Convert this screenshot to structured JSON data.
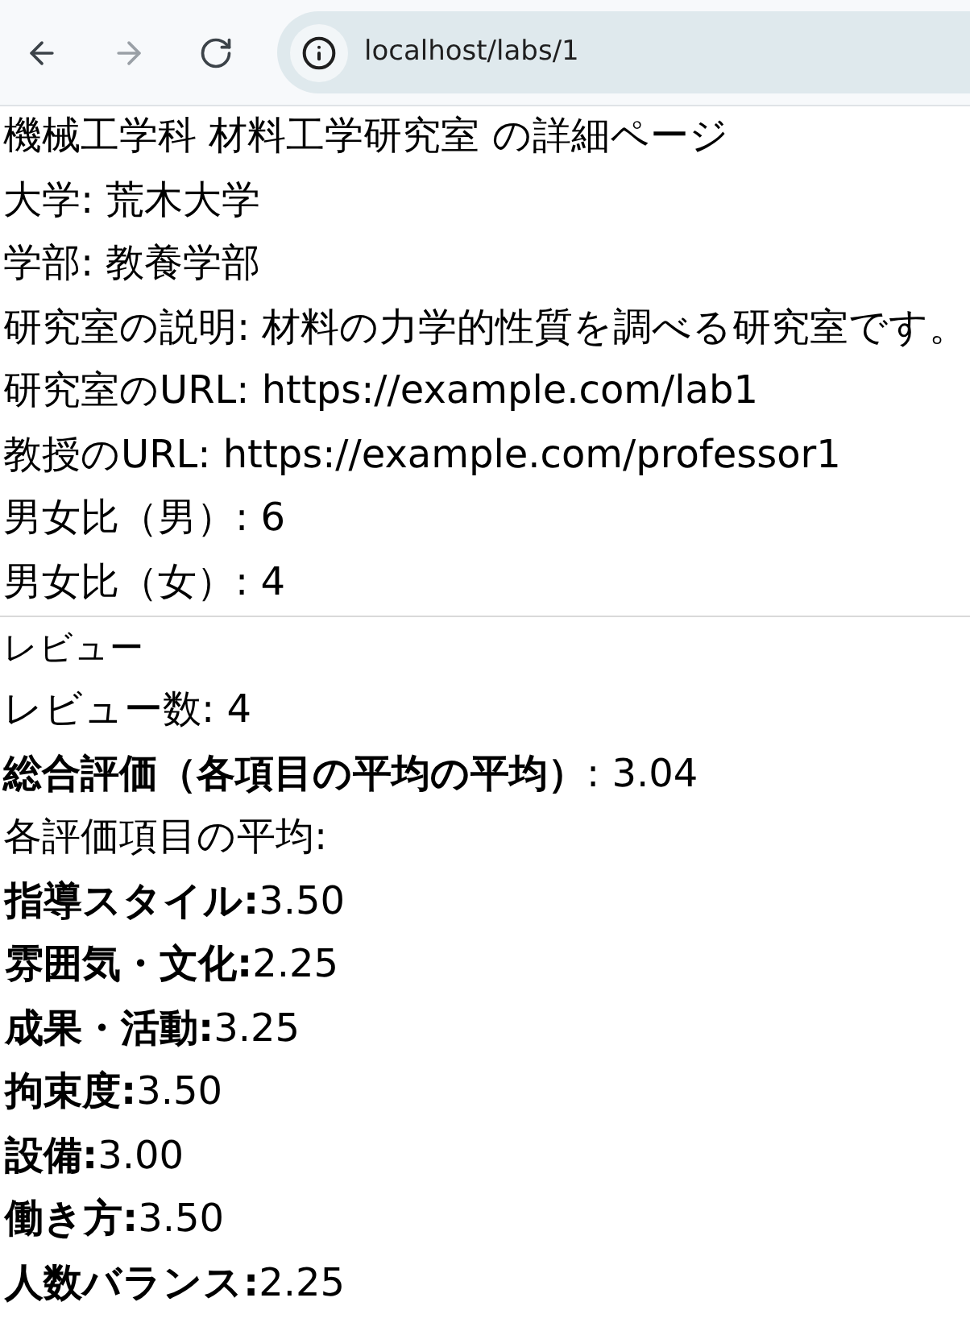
{
  "browser": {
    "nav_buttons": [
      {
        "kind": "back",
        "disabled": false
      },
      {
        "kind": "forward",
        "disabled": true
      },
      {
        "kind": "reload",
        "disabled": false
      }
    ],
    "url": "localhost/labs/1"
  },
  "details": {
    "title": "機械工学科 材料工学研究室 の詳細ページ",
    "lines": [
      "大学: 荒木大学",
      "学部: 教養学部",
      "研究室の説明: 材料の力学的性質を調べる研究室です。",
      "研究室のURL: https://example.com/lab1",
      "教授のURL: https://example.com/professor1",
      "男女比（男）: 6",
      "男女比（女）: 4"
    ]
  },
  "reviews": {
    "heading": "レビュー",
    "count": "レビュー数: 4",
    "overall": "**総合評価（各項目の平均の平均）**: 3.04",
    "averages_label": "各評価項目の平均:",
    "averages": [
      "**指導スタイル:**3.50",
      "**雰囲気・文化:**2.25",
      "**成果・活動:**3.25",
      "**拘束度:**3.50",
      "**設備:**3.00",
      "**働き方:**3.50",
      "**人数バランス:**2.25"
    ]
  }
}
